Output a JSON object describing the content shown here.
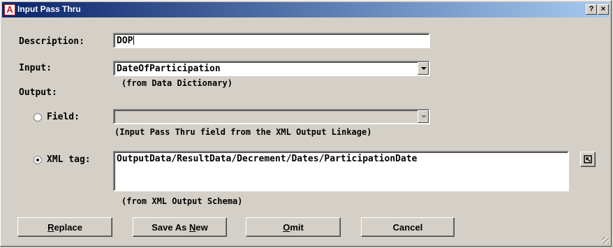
{
  "window": {
    "title": "Input Pass Thru"
  },
  "titlebar_buttons": {
    "help": "?",
    "close": "×"
  },
  "description": {
    "label": "Description:",
    "value": "DOP"
  },
  "input": {
    "label": "Input:",
    "value": "DateOfParticipation",
    "hint": "(from Data Dictionary)"
  },
  "output": {
    "label": "Output:"
  },
  "field": {
    "label": "Field:",
    "value": "",
    "selected": false,
    "hint": "(Input Pass Thru field from the XML Output Linkage)"
  },
  "xml_tag": {
    "label": "XML tag:",
    "value": "OutputData/ResultData/Decrement/Dates/ParticipationDate",
    "selected": true,
    "hint": "(from XML Output Schema)"
  },
  "buttons": [
    {
      "pre": "",
      "mn": "R",
      "post": "eplace"
    },
    {
      "pre": "Save As ",
      "mn": "N",
      "post": "ew"
    },
    {
      "pre": "",
      "mn": "O",
      "post": "mit"
    },
    {
      "pre": "Cancel",
      "mn": "",
      "post": ""
    }
  ]
}
